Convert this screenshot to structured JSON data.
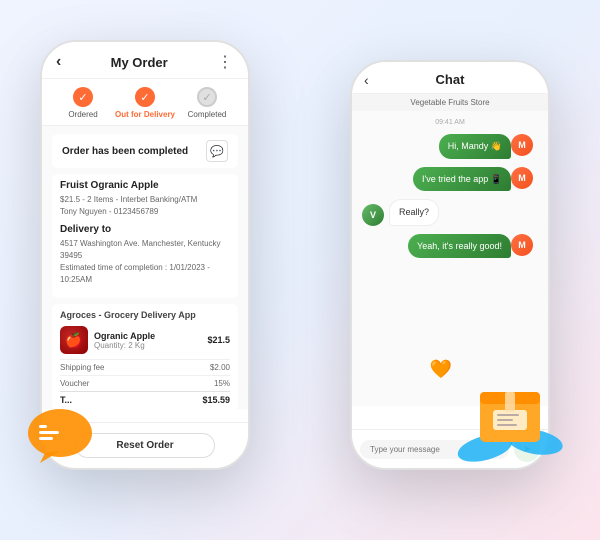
{
  "left_phone": {
    "header": {
      "back_label": "‹",
      "title": "My Order",
      "menu_label": "⋮"
    },
    "steps": [
      {
        "label": "Ordered",
        "state": "done"
      },
      {
        "label": "Out for Delivery",
        "state": "active"
      },
      {
        "label": "Completed",
        "state": "pending"
      }
    ],
    "status_banner": {
      "text": "Order has been completed",
      "icon": "💬"
    },
    "section1": {
      "title": "Fruist Ogranic Apple",
      "line1": "$21.5 - 2 Items - Interbet Banking/ATM",
      "line2": "Tony Nguyen - 0123456789"
    },
    "section2": {
      "title": "Delivery to",
      "address": "4517 Washington Ave. Manchester, Kentucky 39495",
      "eta": "Estimated time of completion : 1/01/2023 - 10:25AM"
    },
    "section3": {
      "store_name": "Agroces - Grocery Delivery App",
      "item_name": "Ogranic Apple",
      "item_qty": "Quantity: 2 Kg",
      "item_price": "$21.5",
      "shipping_label": "Shipping fee",
      "shipping_value": "$2.00",
      "voucher_label": "Voucher",
      "voucher_value": "15%",
      "total_label": "T...",
      "total_value": "$15.59"
    },
    "reset_button": "Reset Order"
  },
  "right_phone": {
    "header": {
      "back_label": "‹",
      "title": "Chat"
    },
    "store_bar": "Vegetable Fruits Store",
    "timestamp": "09:41 AM",
    "messages": [
      {
        "text": "Hi, Mandy 👋",
        "type": "sent",
        "avatar": "M"
      },
      {
        "text": "I've tried the app 📱",
        "type": "sent"
      },
      {
        "text": "Really?",
        "type": "received"
      },
      {
        "text": "Yeah, it's really good!",
        "type": "sent",
        "avatar": "M"
      }
    ],
    "input_placeholder": "Type your message",
    "send_icon": "➤"
  },
  "decorations": {
    "chat_bubble_emoji": "💬",
    "heart_emoji": "🧡",
    "delivery_emoji": "📦"
  }
}
